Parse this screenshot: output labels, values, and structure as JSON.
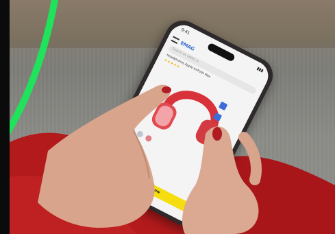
{
  "image": {
    "phone": {
      "logo_text": "EMAG",
      "buy_button_label": "Buy now",
      "search_placeholder": "Search on eMAG.ro",
      "product_title": "Headphones Apple AirPods Max",
      "rating": "★★★★★"
    }
  }
}
